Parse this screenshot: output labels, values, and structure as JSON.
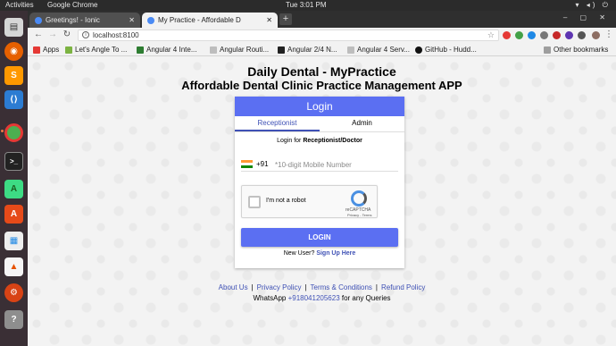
{
  "system": {
    "activities": "Activities",
    "app_name": "Google Chrome",
    "clock": "Tue  3:01 PM"
  },
  "browser": {
    "tabs": [
      {
        "title": "Greetings! - Ionic"
      },
      {
        "title": "My Practice - Affordable D"
      }
    ],
    "address": "localhost:8100",
    "bookmarks": [
      {
        "label": "Apps"
      },
      {
        "label": "Let's Angle To ..."
      },
      {
        "label": "Angular 4 Inte..."
      },
      {
        "label": "Angular Routi..."
      },
      {
        "label": "Angular 2/4 N..."
      },
      {
        "label": "Angular 4 Serv..."
      },
      {
        "label": "GitHub - Hudd..."
      }
    ],
    "other_bookmarks": "Other bookmarks"
  },
  "page": {
    "title": "Daily Dental - MyPractice",
    "subtitle": "Affordable Dental Clinic Practice Management APP",
    "card": {
      "header": "Login",
      "tabs": [
        "Receptionist",
        "Admin"
      ],
      "login_for_prefix": "Login for ",
      "login_for_role": "Receptionist/Doctor",
      "country_code": "+91",
      "phone_placeholder": "*10-digit Mobile Number",
      "captcha_label": "I'm not a robot",
      "captcha_brand": "reCAPTCHA",
      "captcha_terms": "Privacy - Terms",
      "login_button": "LOGIN",
      "new_user_prefix": "New User? ",
      "sign_up": "Sign Up Here"
    },
    "footer": {
      "links": [
        "About Us",
        "Privacy Policy",
        "Terms & Conditions",
        "Refund Policy"
      ],
      "whatsapp_prefix": "WhatsApp ",
      "whatsapp_number": "+918041205623",
      "whatsapp_suffix": " for any Queries"
    }
  },
  "colors": {
    "accent": "#5b6ff2",
    "link": "#3f51b5"
  }
}
